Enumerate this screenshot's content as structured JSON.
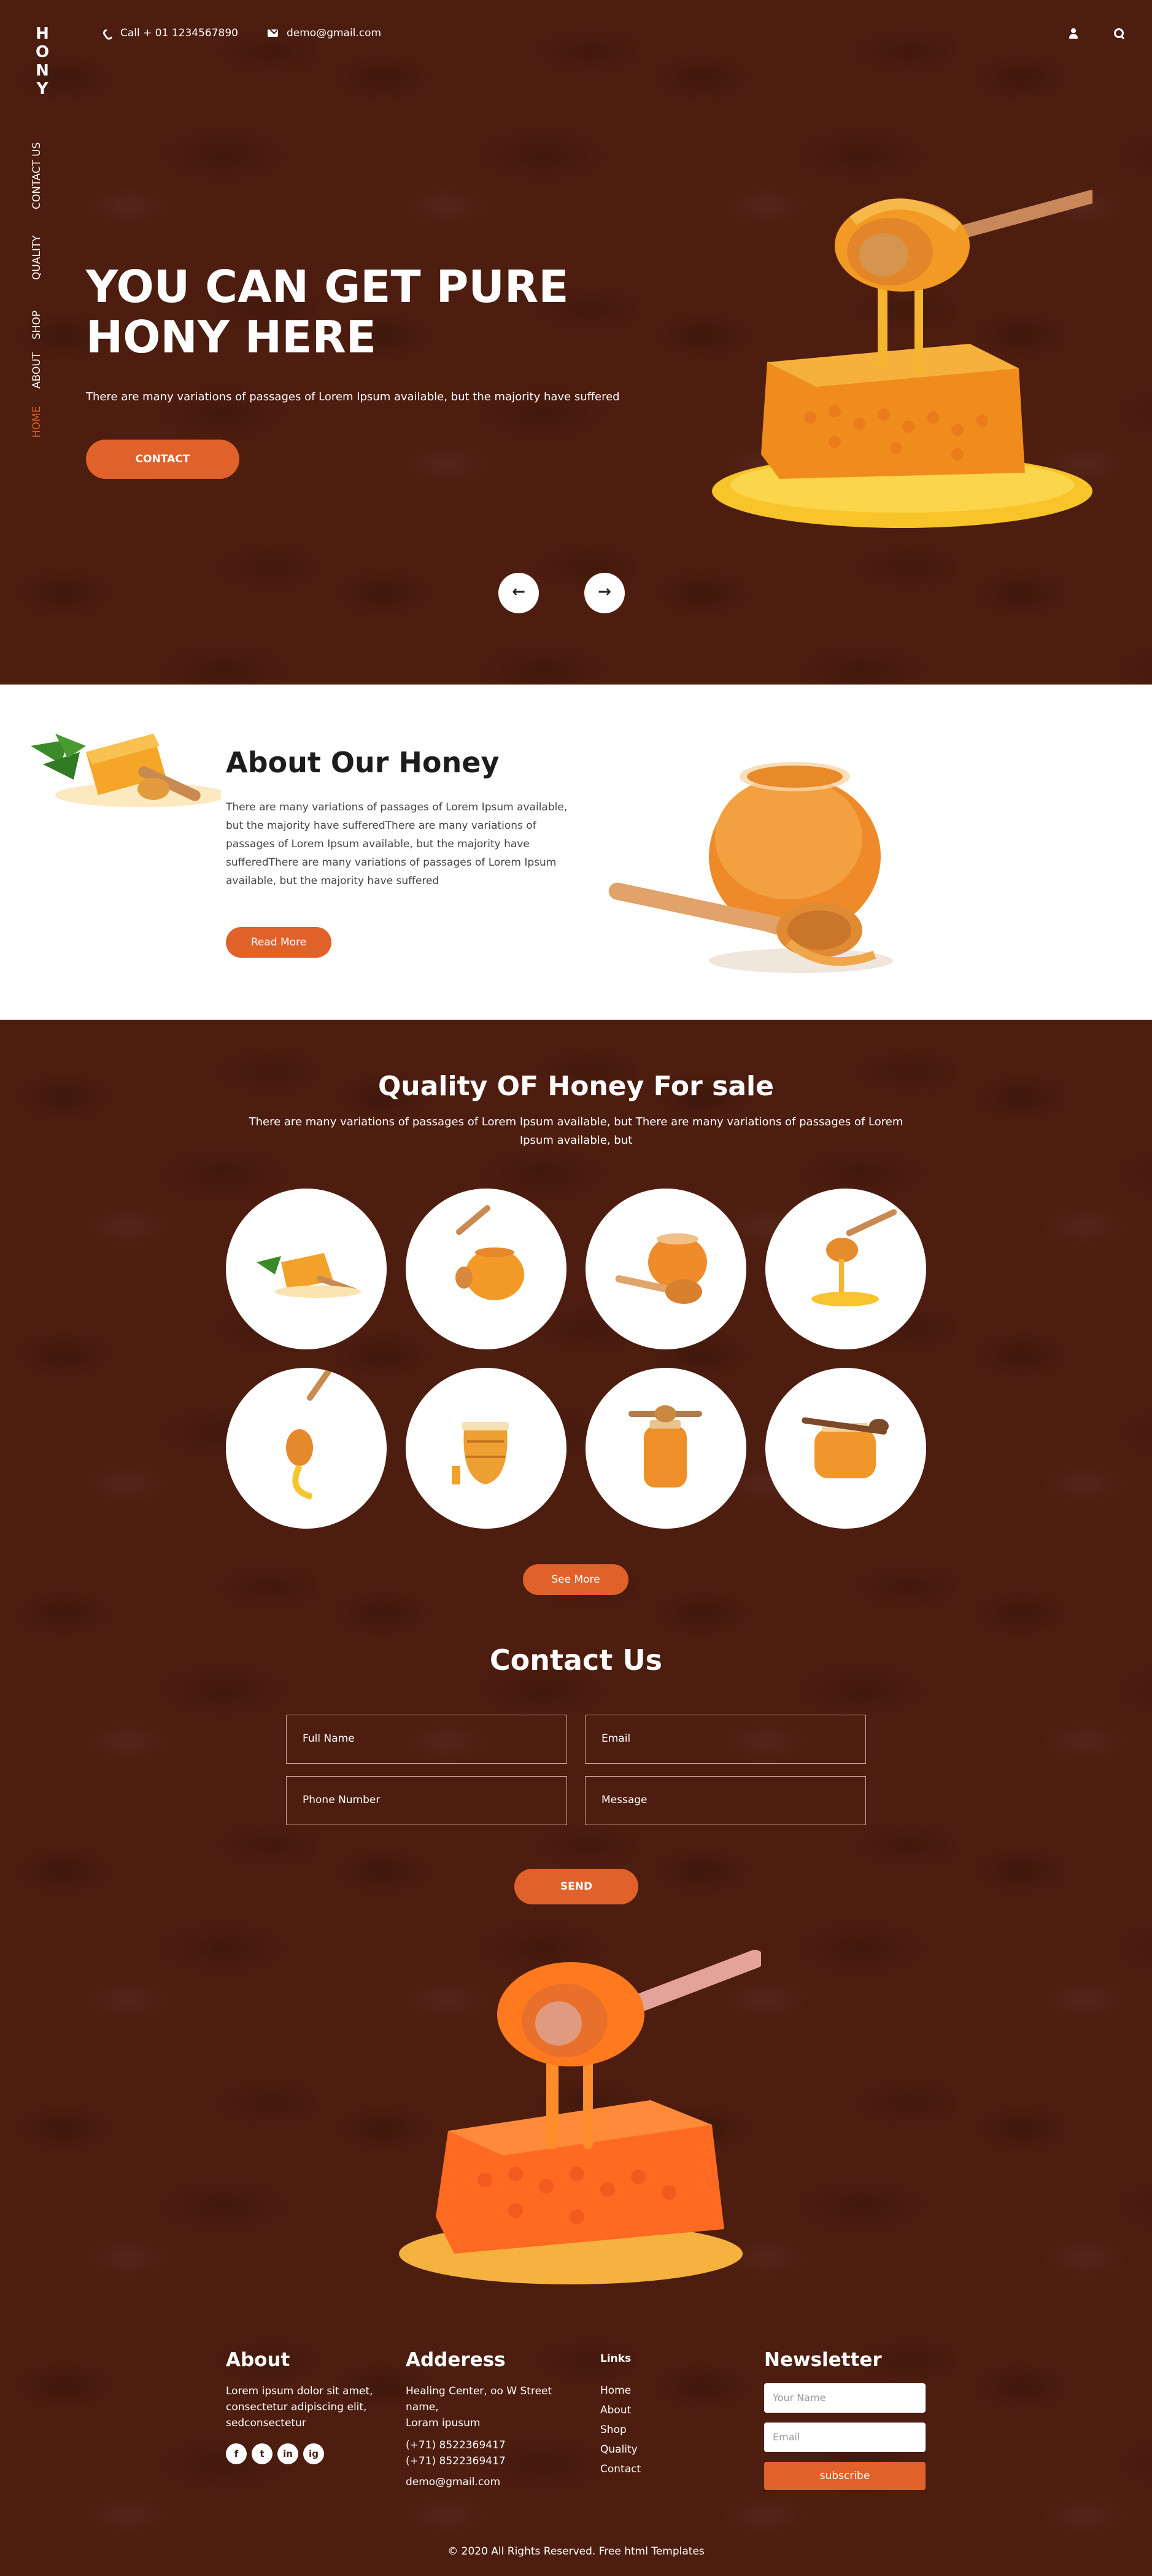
{
  "brand": {
    "letters": [
      "H",
      "O",
      "N",
      "Y"
    ]
  },
  "sidenav": [
    {
      "label": "CONTACT US",
      "active": false
    },
    {
      "label": "QUALITY",
      "active": false
    },
    {
      "label": "SHOP",
      "active": false
    },
    {
      "label": "ABOUT",
      "active": false
    },
    {
      "label": "HOME",
      "active": true
    }
  ],
  "topbar": {
    "phone": "Call + 01 1234567890",
    "email": "demo@gmail.com",
    "icons": [
      "user-icon",
      "search-icon"
    ]
  },
  "hero": {
    "title_line1": "YOU CAN GET PURE",
    "title_line2": "HONY HERE",
    "text": "There are many variations of passages of Lorem Ipsum available, but the majority have suffered",
    "button": "CONTACT",
    "prev": "←",
    "next": "→"
  },
  "about": {
    "title": "About Our Honey",
    "text": "There are many variations of passages of Lorem Ipsum available, but the majority have sufferedThere are many variations of passages of Lorem Ipsum available, but the majority have sufferedThere are many variations of passages of Lorem Ipsum available, but the majority have suffered",
    "button": "Read More"
  },
  "quality": {
    "title": "Quality OF Honey For sale",
    "subtitle": "There are many variations of passages of Lorem Ipsum available, but There are many variations of passages of Lorem Ipsum available, but",
    "products": [
      "honeycomb-dipper",
      "dipper-jar",
      "jar-with-dipper",
      "dripping-dipper",
      "dipper-splash",
      "honey-pot",
      "dipper-on-jar",
      "round-jar"
    ],
    "button": "See More"
  },
  "contact": {
    "title": "Contact Us",
    "full_name": "Full Name",
    "email": "Email",
    "phone": "Phone Number",
    "message": "Message",
    "button": "SEND"
  },
  "footer": {
    "about_title": "About",
    "about_text": "Lorem ipsum dolor sit amet, consectetur adipiscing elit, sedconsectetur",
    "social": [
      "f",
      "t",
      "in",
      "ig"
    ],
    "address_title": "Adderess",
    "address_line1": "Healing Center, oo W Street name,",
    "address_line2": "Loram ipusum",
    "phone1": "(+71) 8522369417",
    "phone2": "(+71) 8522369417",
    "email": "demo@gmail.com",
    "links_title": "Links",
    "links": [
      "Home",
      "About",
      "Shop",
      "Quality",
      "Contact"
    ],
    "newsletter_title": "Newsletter",
    "name_placeholder": "Your Name",
    "email_placeholder": "Email",
    "subscribe": "subscribe",
    "copyright": "© 2020 All Rights Reserved. Free html Templates"
  },
  "colors": {
    "bg": "#4d1d0f",
    "accent": "#e0612a",
    "white": "#ffffff"
  }
}
